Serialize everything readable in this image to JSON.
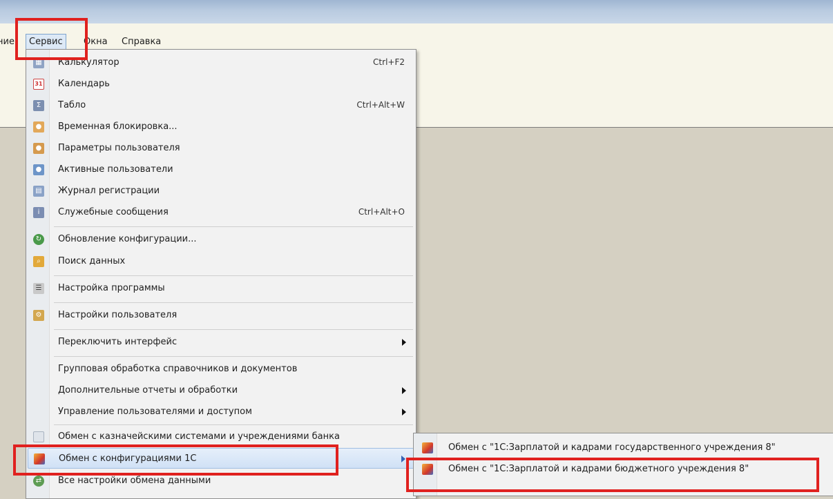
{
  "menubar": {
    "prev_fragment": "ние",
    "service": "Сервис",
    "windows": "Окна",
    "help": "Справка"
  },
  "service_menu": {
    "items": [
      {
        "label": "Калькулятор",
        "shortcut": "Ctrl+F2",
        "icon": "calculator-icon"
      },
      {
        "label": "Календарь",
        "shortcut": "",
        "icon": "calendar-icon"
      },
      {
        "label": "Табло",
        "shortcut": "Ctrl+Alt+W",
        "icon": "scoreboard-icon"
      },
      {
        "label": "Временная блокировка...",
        "shortcut": "",
        "icon": "lock-user-icon"
      },
      {
        "label": "Параметры пользователя",
        "shortcut": "",
        "icon": "user-settings-icon"
      },
      {
        "label": "Активные пользователи",
        "shortcut": "",
        "icon": "active-users-icon"
      },
      {
        "label": "Журнал регистрации",
        "shortcut": "",
        "icon": "log-icon"
      },
      {
        "label": "Служебные сообщения",
        "shortcut": "Ctrl+Alt+O",
        "icon": "messages-icon"
      },
      {
        "label": "Обновление конфигурации...",
        "shortcut": "",
        "icon": "update-icon"
      },
      {
        "label": "Поиск данных",
        "shortcut": "",
        "icon": "search-data-icon"
      },
      {
        "label": "Настройка программы",
        "shortcut": "",
        "icon": "program-settings-icon"
      },
      {
        "label": "Настройки пользователя",
        "shortcut": "",
        "icon": "user-prefs-icon"
      },
      {
        "label": "Переключить интерфейс",
        "shortcut": "",
        "icon": ""
      },
      {
        "label": "Групповая обработка справочников и документов",
        "shortcut": "",
        "icon": ""
      },
      {
        "label": "Дополнительные отчеты и обработки",
        "shortcut": "",
        "icon": ""
      },
      {
        "label": "Управление пользователями и доступом",
        "shortcut": "",
        "icon": ""
      },
      {
        "label": "Обмен с казначейскими системами и учреждениями банка",
        "shortcut": "",
        "icon": "treasury-exchange-icon"
      },
      {
        "label": "Обмен с конфигурациями 1С",
        "shortcut": "",
        "icon": "exchange-1c-icon"
      },
      {
        "label": "Все настройки обмена данными",
        "shortcut": "",
        "icon": "exchange-settings-icon"
      }
    ]
  },
  "exchange_submenu": {
    "items": [
      {
        "label": "Обмен с \"1С:Зарплатой и кадрами государственного учреждения 8\"",
        "icon": "exchange-1c-icon"
      },
      {
        "label": "Обмен с \"1С:Зарплатой и кадрами бюджетного учреждения 8\"",
        "icon": "exchange-1c-icon"
      }
    ]
  },
  "colors": {
    "highlight_box": "#e0211f",
    "menu_bg": "#f2f2f2",
    "workspace": "#d5d0c2"
  }
}
